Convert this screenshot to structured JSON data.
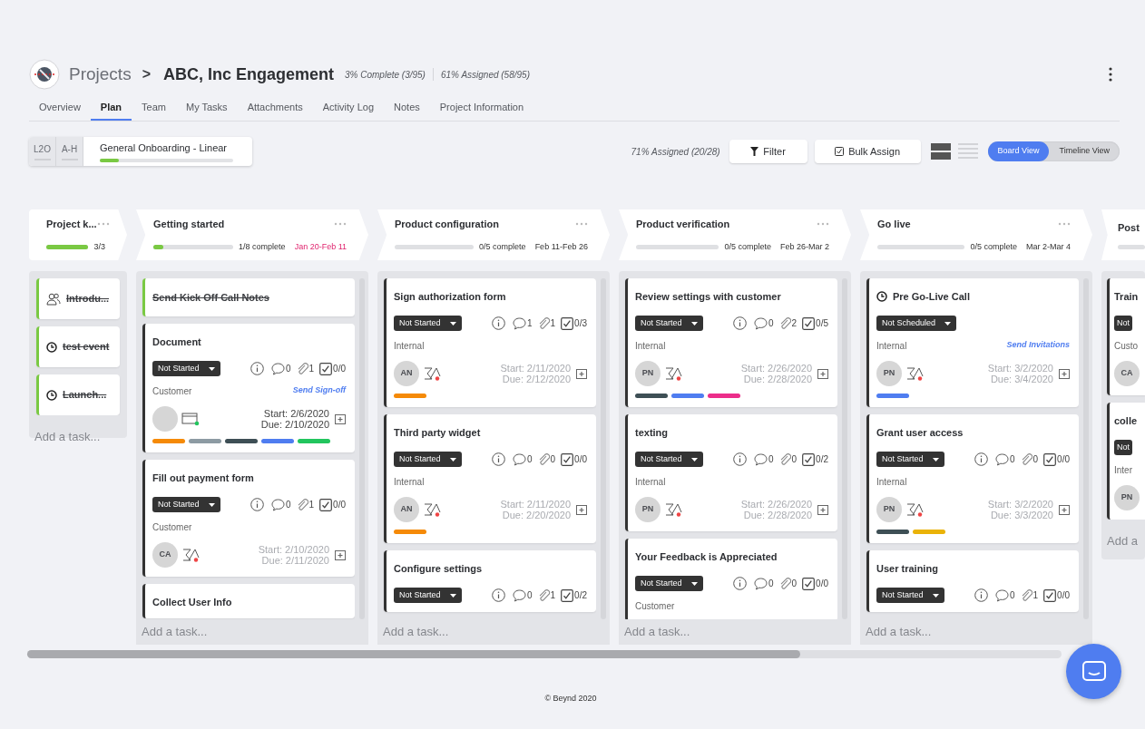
{
  "header": {
    "root": "Projects",
    "separator": ">",
    "project": "ABC, Inc Engagement",
    "complete": "3% Complete (3/95)",
    "assigned": "61% Assigned (58/95)"
  },
  "tabs": [
    {
      "label": "Overview",
      "selected": false
    },
    {
      "label": "Plan",
      "selected": true
    },
    {
      "label": "Team",
      "selected": false
    },
    {
      "label": "My Tasks",
      "selected": false
    },
    {
      "label": "Attachments",
      "selected": false
    },
    {
      "label": "Activity Log",
      "selected": false
    },
    {
      "label": "Notes",
      "selected": false
    },
    {
      "label": "Project Information",
      "selected": false
    }
  ],
  "plan": {
    "segments": [
      "L2O",
      "A-H"
    ],
    "name": "General Onboarding - Linear",
    "level": 0.14
  },
  "toolbar": {
    "assigned": "71% Assigned (20/28)",
    "buttons": [
      {
        "label": "Filter",
        "kind": "filter"
      },
      {
        "label": "Bulk Assign",
        "kind": "bulk"
      }
    ],
    "layouts": [
      {
        "kind": "cards",
        "selected": true
      },
      {
        "kind": "list",
        "selected": false
      }
    ],
    "views": [
      {
        "label": "Board View",
        "selected": true
      },
      {
        "label": "Timeline View",
        "selected": false
      }
    ]
  },
  "stages": [
    {
      "kind": "collapsed",
      "title": "Project k...",
      "level": 1,
      "progress": "3/3",
      "tasks": [
        {
          "kind": "meeting",
          "title": "Introdu...",
          "completed": true
        },
        {
          "kind": "event",
          "title": "test event",
          "completed": true
        },
        {
          "kind": "event",
          "title": "Launch...",
          "completed": true
        }
      ],
      "add_label": "Add a task..."
    },
    {
      "kind": "full",
      "title": "Getting started",
      "level": 0.125,
      "progress": "1/8 complete",
      "dates": "Jan 20-Feb 11",
      "overdue": true,
      "tasks": [
        {
          "kind": "task",
          "title": "Send Kick Off Call Notes",
          "completed": true
        },
        {
          "kind": "task",
          "title": "Document",
          "completed": false,
          "status": "Not Started",
          "comments": "0",
          "attachments": "1",
          "checklist": "0/0",
          "audience": "Customer",
          "action": "Send Sign-off",
          "start": "Start: 2/6/2020",
          "due": "Due: 2/10/2020",
          "dates_dim": false,
          "tags": [
            {
              "color": "#f58a07"
            },
            {
              "color": "#8d9ba3"
            },
            {
              "color": "#3e4f55"
            },
            {
              "color": "#4f7df0"
            },
            {
              "color": "#22c55e"
            }
          ]
        },
        {
          "kind": "task",
          "title": "Fill out payment form",
          "completed": false,
          "status": "Not Started",
          "comments": "0",
          "attachments": "1",
          "checklist": "0/0",
          "audience": "Customer",
          "assignee": "CA",
          "start": "Start: 2/10/2020",
          "due": "Due: 2/11/2020",
          "dates_dim": true
        },
        {
          "kind": "task",
          "title": "Collect User Info",
          "completed": false
        }
      ],
      "add_label": "Add a task..."
    },
    {
      "kind": "full",
      "title": "Product configuration",
      "level": 0,
      "progress": "0/5 complete",
      "dates": "Feb 11-Feb 26",
      "overdue": false,
      "tasks": [
        {
          "kind": "task",
          "title": "Sign authorization form",
          "completed": false,
          "status": "Not Started",
          "comments": "1",
          "attachments": "1",
          "checklist": "0/3",
          "audience": "Internal",
          "assignee": "AN",
          "start": "Start: 2/11/2020",
          "due": "Due: 2/12/2020",
          "dates_dim": true,
          "tags": [
            {
              "color": "#f58a07"
            }
          ]
        },
        {
          "kind": "task",
          "title": "Third party widget",
          "completed": false,
          "status": "Not Started",
          "comments": "0",
          "attachments": "0",
          "checklist": "0/0",
          "audience": "Internal",
          "assignee": "AN",
          "start": "Start: 2/11/2020",
          "due": "Due: 2/20/2020",
          "dates_dim": true,
          "tags": [
            {
              "color": "#f58a07"
            }
          ]
        },
        {
          "kind": "task",
          "title": "Configure settings",
          "completed": false,
          "status": "Not Started",
          "comments": "0",
          "attachments": "1",
          "checklist": "0/2"
        }
      ],
      "add_label": "Add a task..."
    },
    {
      "kind": "full",
      "title": "Product verification",
      "level": 0,
      "progress": "0/5 complete",
      "dates": "Feb 26-Mar 2",
      "overdue": false,
      "tasks": [
        {
          "kind": "task",
          "title": "Review settings with customer",
          "completed": false,
          "status": "Not Started",
          "comments": "0",
          "attachments": "2",
          "checklist": "0/5",
          "audience": "Internal",
          "assignee": "PN",
          "start": "Start: 2/26/2020",
          "due": "Due: 2/28/2020",
          "dates_dim": true,
          "tags": [
            {
              "color": "#3e4f55"
            },
            {
              "color": "#4f7df0"
            },
            {
              "color": "#ec2d8a"
            }
          ]
        },
        {
          "kind": "task",
          "title": "texting",
          "completed": false,
          "status": "Not Started",
          "comments": "0",
          "attachments": "0",
          "checklist": "0/2",
          "audience": "Internal",
          "assignee": "PN",
          "start": "Start: 2/26/2020",
          "due": "Due: 2/28/2020",
          "dates_dim": true
        },
        {
          "kind": "task",
          "title": "Your Feedback is Appreciated",
          "completed": false,
          "status": "Not Started",
          "comments": "0",
          "attachments": "0",
          "checklist": "0/0",
          "audience": "Customer"
        }
      ],
      "add_label": "Add a task..."
    },
    {
      "kind": "full",
      "title": "Go live",
      "level": 0,
      "progress": "0/5 complete",
      "dates": "Mar 2-Mar 4",
      "overdue": false,
      "tasks": [
        {
          "kind": "event",
          "title": "Pre Go-Live Call",
          "completed": false,
          "status": "Not Scheduled",
          "audience": "Internal",
          "action": "Send Invitations",
          "assignee": "PN",
          "start": "Start: 3/2/2020",
          "due": "Due: 3/4/2020",
          "dates_dim": true,
          "tags": [
            {
              "color": "#4f7df0"
            }
          ]
        },
        {
          "kind": "task",
          "title": "Grant user access",
          "completed": false,
          "status": "Not Started",
          "comments": "0",
          "attachments": "0",
          "checklist": "0/0",
          "audience": "Internal",
          "assignee": "PN",
          "start": "Start: 3/2/2020",
          "due": "Due: 3/3/2020",
          "dates_dim": true,
          "tags": [
            {
              "color": "#3e4f55"
            },
            {
              "color": "#eab308"
            }
          ]
        },
        {
          "kind": "task",
          "title": "User training",
          "completed": false,
          "status": "Not Started",
          "comments": "0",
          "attachments": "1",
          "checklist": "0/0"
        }
      ],
      "add_label": "Add a task..."
    },
    {
      "kind": "partial",
      "title": "Post",
      "tasks": [
        {
          "kind": "task",
          "title": "Train",
          "completed": false,
          "status": "Not",
          "audience": "Custo",
          "assignee": "CA"
        },
        {
          "kind": "task",
          "title": "colle",
          "completed": false,
          "status": "Not",
          "audience": "Inter",
          "assignee": "PN"
        }
      ],
      "add_label": "Add a"
    }
  ],
  "footer": "© Beynd 2020"
}
